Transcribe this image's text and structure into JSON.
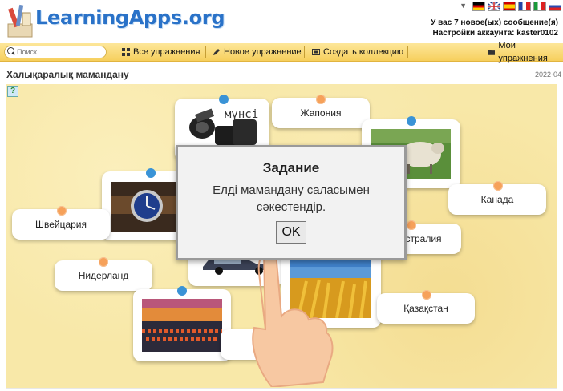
{
  "header": {
    "logo_text": "LearningApps.org",
    "messages": "У вас 7 новое(ых) сообщение(я)",
    "account": "Настройки аккаунта: kaster0102",
    "flag_dropdown": "▼"
  },
  "toolbar": {
    "search_placeholder": "Поиск",
    "all_exercises": "Все упражнения",
    "new_exercise": "Новое упражнение",
    "create_collection": "Создать коллекцию",
    "my_exercises": "Мои упражнения"
  },
  "page": {
    "title": "Халықаралық мамандану",
    "date": "2022-04"
  },
  "cards": {
    "japan": "Жапония",
    "canada": "Канада",
    "switzerland": "Швейцария",
    "australia_partial": "стралия",
    "netherlands": "Нидерланд",
    "kazakhstan": "Қазақстан"
  },
  "images": {
    "camera_caption": "мүнсі",
    "icons": [
      "help-icon",
      "camera-image",
      "sheep-image",
      "watch-image",
      "car-image",
      "tulips-image",
      "wheat-image",
      "pointing-hand-icon"
    ]
  },
  "dialog": {
    "title": "Задание",
    "text": "Елді мамандану саласымен сәкестендір.",
    "ok_label": "OK"
  },
  "colors": {
    "logo": "#2a72c8",
    "toolbar": "#f6cf5d",
    "stage": "#f8e8a8",
    "pin_orange": "#f6a15a",
    "pin_blue": "#3a93d6"
  }
}
